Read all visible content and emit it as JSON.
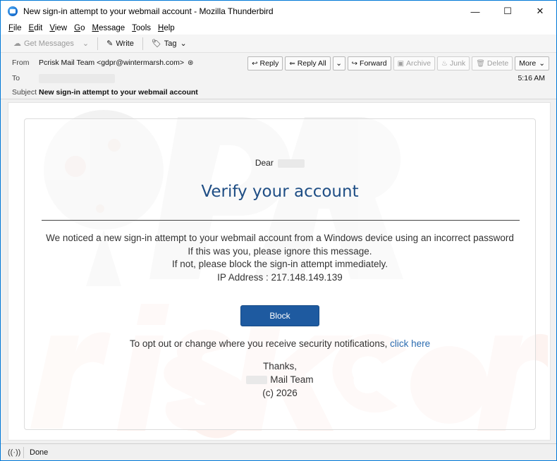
{
  "window": {
    "title": "New sign-in attempt to your webmail account - Mozilla Thunderbird",
    "controls": {
      "minimize": "—",
      "maximize": "☐",
      "close": "✕"
    }
  },
  "menu": [
    {
      "key": "F",
      "rest": "ile"
    },
    {
      "key": "E",
      "rest": "dit"
    },
    {
      "key": "V",
      "rest": "iew"
    },
    {
      "key": "G",
      "rest": "o"
    },
    {
      "key": "M",
      "rest": "essage"
    },
    {
      "key": "T",
      "rest": "ools"
    },
    {
      "key": "H",
      "rest": "elp"
    }
  ],
  "toolbar": {
    "get_messages": "Get Messages",
    "write": "Write",
    "tag": "Tag"
  },
  "headers": {
    "from_label": "From",
    "from_value": "Pcrisk Mail Team <gdpr@wintermarsh.com>",
    "to_label": "To",
    "subject_label": "Subject",
    "subject_value": "New sign-in attempt to your webmail account",
    "time": "5:16 AM"
  },
  "actions": {
    "reply": "Reply",
    "reply_all": "Reply All",
    "forward": "Forward",
    "archive": "Archive",
    "junk": "Junk",
    "delete": "Delete",
    "more": "More"
  },
  "message": {
    "dear": "Dear",
    "heading": "Verify your account",
    "lines": [
      "We noticed a new sign-in attempt to your webmail account from a Windows device using an incorrect password",
      "If this was you, please ignore this message.",
      "If not, please block the sign-in attempt immediately.",
      "IP Address : 217.148.149.139"
    ],
    "block_button": "Block",
    "optout_text": "To opt out or change where you receive security notifications,",
    "optout_link": "click here",
    "thanks": "Thanks,",
    "team": "Mail Team",
    "copyright": "(c) 2026"
  },
  "status": {
    "text": "Done"
  },
  "icons": {
    "app": "thunderbird-icon",
    "get_messages": "cloud-download-icon",
    "write": "pencil-icon",
    "tag": "tag-icon",
    "reply": "reply-arrow-icon",
    "reply_all": "reply-all-arrow-icon",
    "forward": "forward-arrow-icon",
    "archive": "archive-box-icon",
    "junk": "flame-icon",
    "delete": "trash-icon",
    "status": "radio-signal-icon"
  },
  "colors": {
    "accent": "#1e5aa0",
    "heading": "#1f4e85",
    "link": "#2b6cb0"
  }
}
